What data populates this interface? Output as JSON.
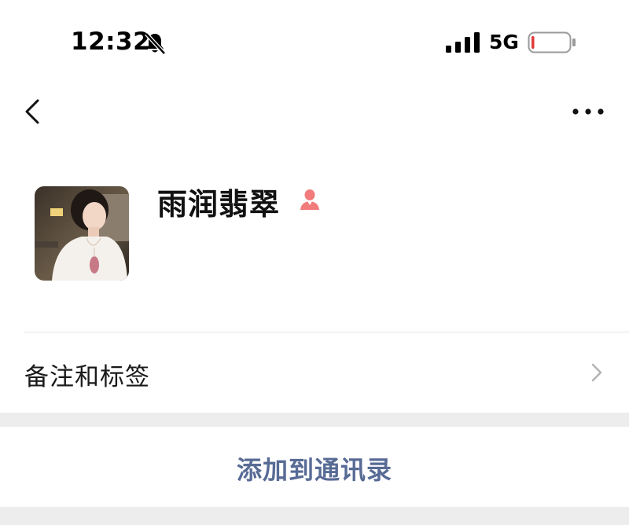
{
  "status_bar": {
    "time": "12:32",
    "network": "5G",
    "silent_icon": "bell-slash-icon",
    "signal_icon": "signal-bars-icon",
    "battery_icon": "battery-low-icon",
    "battery_level_fraction": 0.05,
    "battery_color": "#e03a3a"
  },
  "nav": {
    "back_icon": "chevron-left-icon",
    "more_icon": "more-dots-icon"
  },
  "profile": {
    "name": "雨润翡翠",
    "gender_icon": "female-icon",
    "gender_color": "#f27b7b"
  },
  "remark_row": {
    "label": "备注和标签",
    "arrow_icon": "chevron-right-icon"
  },
  "add_contact": {
    "label": "添加到通讯录",
    "color": "#576b95"
  }
}
